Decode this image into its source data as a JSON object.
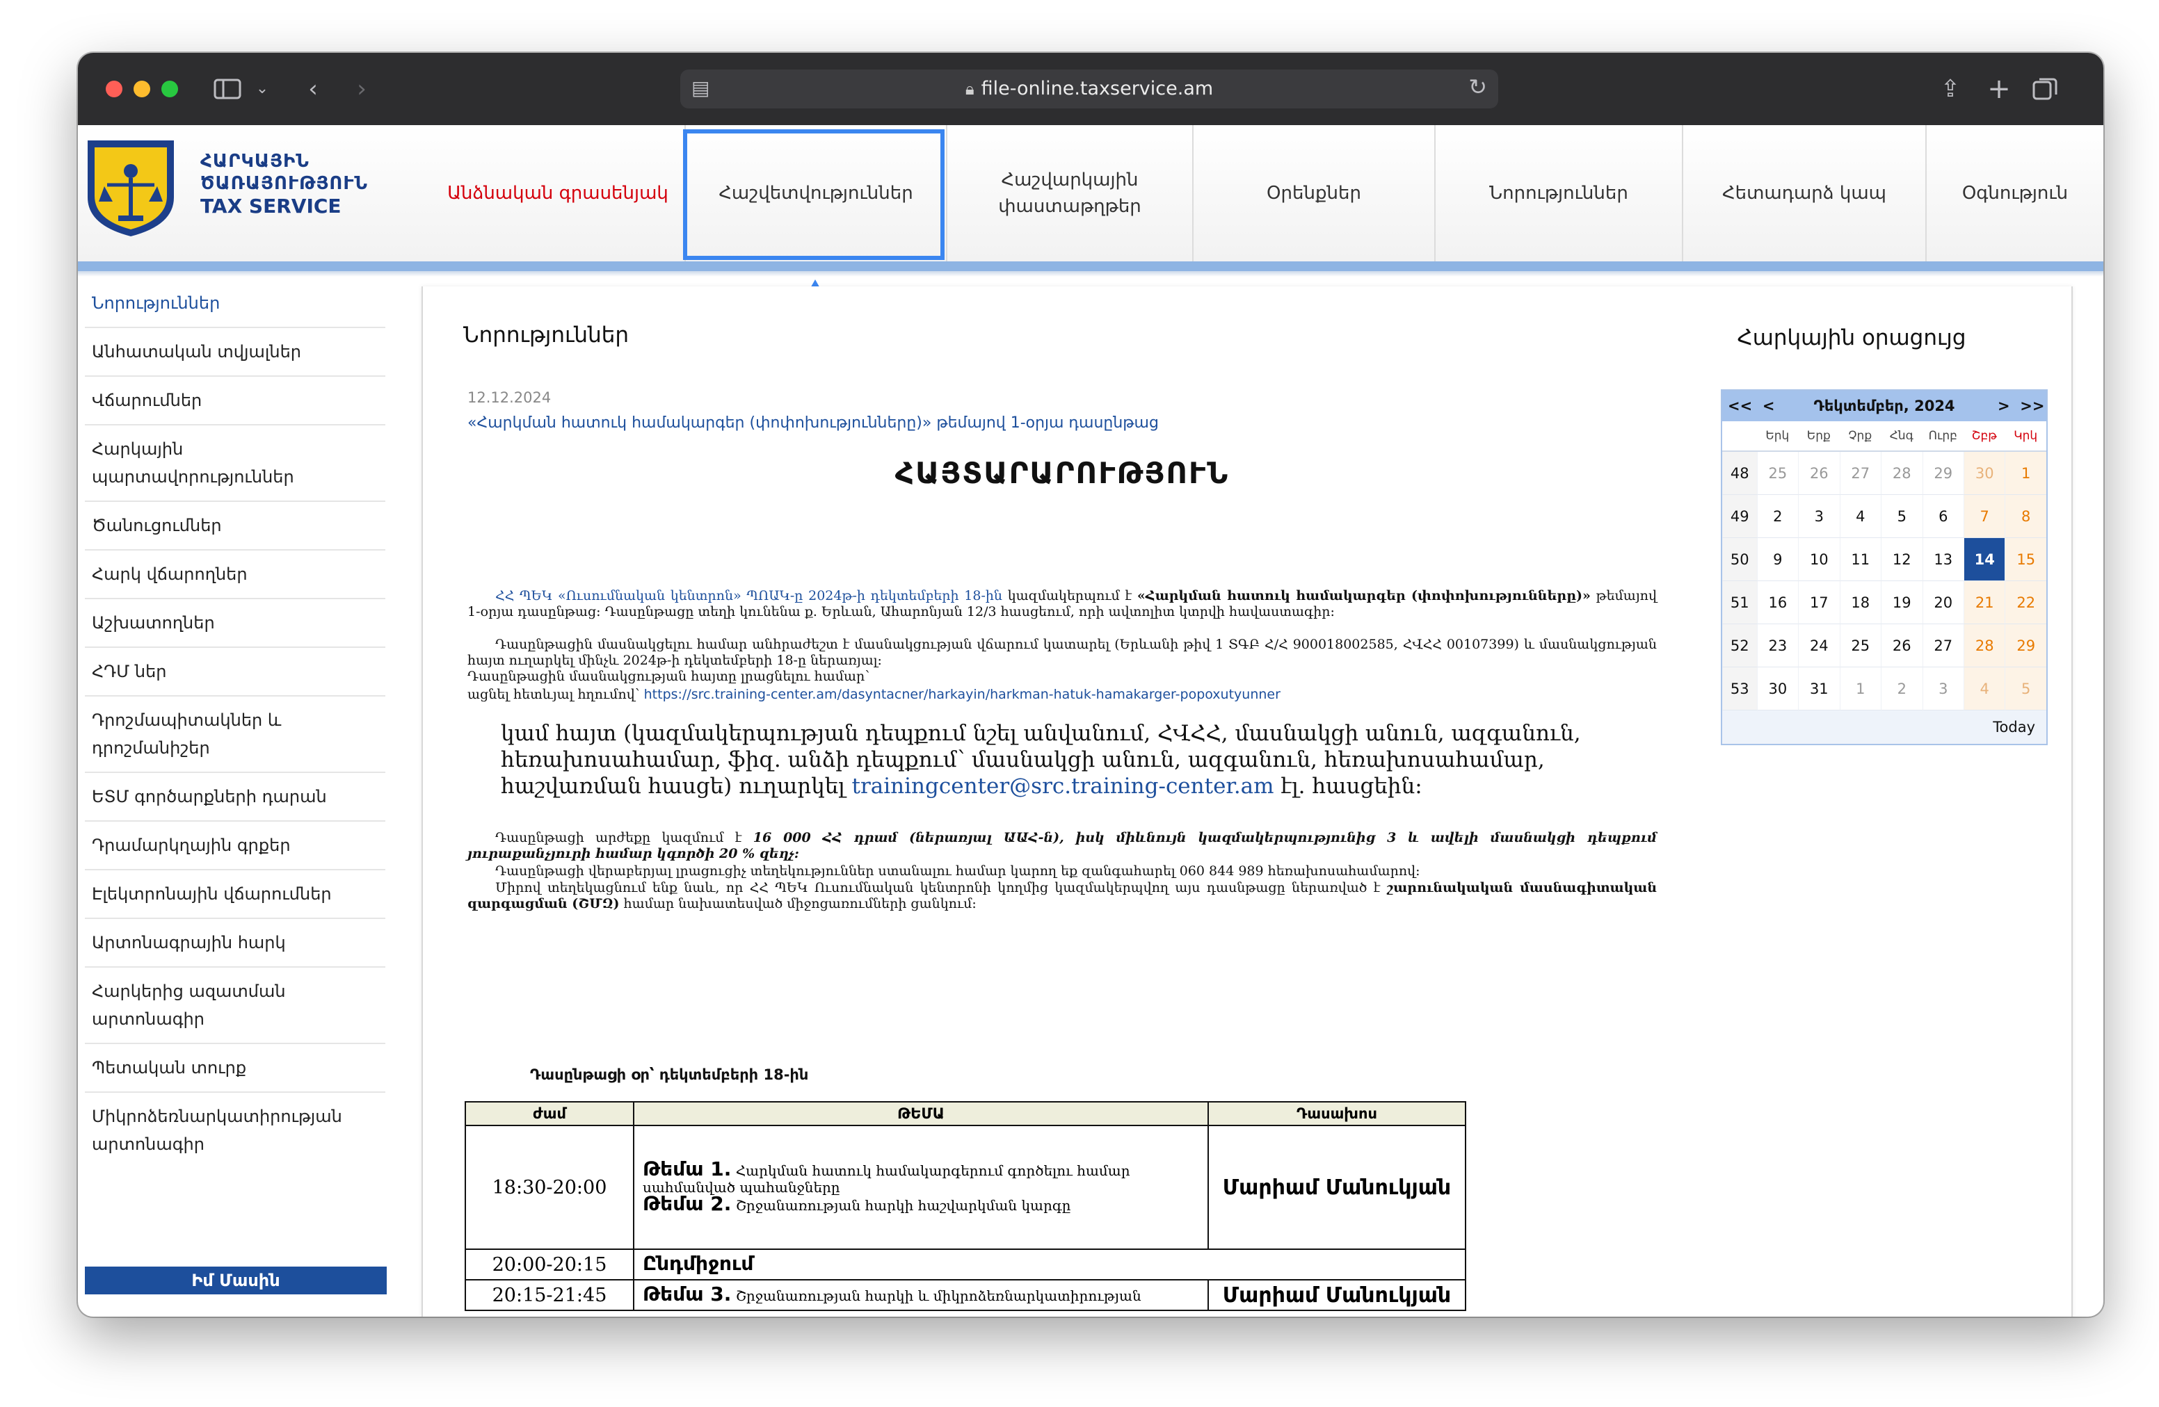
{
  "browser": {
    "url": "file-online.taxservice.am"
  },
  "site": {
    "logo_line1": "ՀԱՐԿԱՅԻՆ",
    "logo_line2": "ԾԱՌԱՅՈՒԹՅՈՒՆ",
    "logo_line3": "TAX SERVICE",
    "nav": [
      {
        "label": "Անձնական գրասենյակ"
      },
      {
        "label": "Հաշվետվություններ"
      },
      {
        "label": "Հաշվարկային փաստաթղթեր"
      },
      {
        "label": "Օրենքներ"
      },
      {
        "label": "Նորություններ"
      },
      {
        "label": "Հետադարձ կապ"
      },
      {
        "label": "Օգնություն"
      }
    ]
  },
  "sidebar": {
    "items": [
      {
        "label": "Նորություններ"
      },
      {
        "label": "Անհատական տվյալներ"
      },
      {
        "label": "Վճարումներ"
      },
      {
        "label": "Հարկային պարտավորություններ"
      },
      {
        "label": "Ծանուցումներ"
      },
      {
        "label": "Հարկ վճարողներ"
      },
      {
        "label": "Աշխատողներ"
      },
      {
        "label": "ՀԴՄ ներ"
      },
      {
        "label": "Դրոշմապիտակներ և դրոշմանիշեր"
      },
      {
        "label": "ԵՏՄ գործարքների դարան"
      },
      {
        "label": "Դրամարկղային գրքեր"
      },
      {
        "label": "Էլեկտրոնային վճարումներ"
      },
      {
        "label": "Արտոնագրային հարկ"
      },
      {
        "label": "Հարկերից ազատման արտոնագիր"
      },
      {
        "label": "Պետական տուրք"
      },
      {
        "label": "Միկրոձեռնարկատիրության արտոնագիր"
      }
    ],
    "bottom_button": "Իմ Մասին"
  },
  "news": {
    "section_title": "Նորություններ",
    "date": "12.12.2024",
    "headline": "«Հարկման հատուկ համակարգեր (փոփոխությունները)» թեմայով 1-օրյա դասընթաց",
    "announcement": "ՀԱՅՏԱՐԱՐՈՒԹՅՈՒՆ",
    "p1_blue": "ՀՀ ՊԵԿ «Ուսումնական կենտրոն» ՊՈԱԿ-ը 2024թ-ի դեկտեմբերի 18-ին",
    "p1_rest_a": " կազմակերպում է ",
    "p1_bold": "«Հարկման հատուկ համակարգեր (փոփոխությունները)»",
    "p1_rest_b": " թեմայով 1-օրյա դասընթաց: Դասընթացը տեղի կունենա ք. Երևան, Ահարոնյան 12/3 հասցեում, որի ավտոլիտ կտրվի հավաստագիր:",
    "p2": "Դասընթացին մասնակցելու համար անհրաժեշտ է մասնակցության վճարում կատարել (Երևանի թիվ 1 ՏԳԲ Հ/Հ 900018002585, ՀՎՀՀ 00107399) և մասնակցության հայտ ուղարկել մինչև 2024թ-ի դեկտեմբերի 18-ը ներառյալ:",
    "p3": "Դասընթացին մասնակցության հայտը լրացնելու համար՝",
    "p4_prefix": "ացնել հետևյալ հղումով՝ ",
    "p4_link": "https://src.training-center.am/dasyntacner/harkayin/harkman-hatuk-hamakarger-popoxutyunner",
    "big_text": "կամ հայտ (կազմակերպության դեպքում նշել անվանում, ՀՎՀՀ, մասնակցի անուն, ազգանուն, հեռախոսահամար, ֆիզ. անձի դեպքում՝ մասնակցի անուն, ազգանուն, հեռախոսահամար, հաշվառման հասցե) ուղարկել ",
    "big_email": "trainingcenter@src.training-center.am",
    "big_tail": " էլ. հասցեին:",
    "p5_a": "Դասընթացի արժեքը կազմում է ",
    "p5_bold": "16 000 ՀՀ դրամ (ներառյալ ԱԱՀ-ն), իսկ միևնույն կազմակերպությունից 3 և ավելի մասնակցի դեպքում յուրաքանչյուրի համար կգործի 20 % զեղչ:",
    "p6": "Դասընթացի վերաբերյալ լրացուցիչ տեղեկություններ ստանալու համար կարող եք զանգահարել 060 844 989 հեռախոսահամարով:",
    "p7_a": "Միրով տեղեկացնում ենք նաև, որ ՀՀ ՊԵԿ Ուսումնական կենտրոնի կողմից կազմակերպվող այս դասնթացը ներառված է ",
    "p7_bold1": "շարունակական մասնագիտական զարգացման (ՇՄԶ)",
    "p7_b": " համար նախատեսված միջոցառումների ցանկում:",
    "lesson_day": "Դասընթացի օր՝ դեկտեմբերի 18-ին",
    "schedule": {
      "headers": [
        "ժամ",
        "ԹԵՄԱ",
        "Դասախոս"
      ],
      "rows": [
        {
          "time": "18:30-20:00",
          "topic1_title": "Թեմա 1.",
          "topic1_text": "Հարկման հատուկ համակարգերում գործելու համար սահմանված պահանջները",
          "topic2_title": "Թեմա 2.",
          "topic2_text": "Շրջանառության հարկի հաշվարկման կարգը",
          "teacher": "Մարիամ Մանուկյան"
        },
        {
          "time": "20:00-20:15",
          "topic1_title": "Ընդմիջում"
        },
        {
          "time": "20:15-21:45",
          "topic1_title": "Թեմա 3.",
          "topic1_text": "Շրջանառության հարկի և միկրոձեռնարկատիրության",
          "teacher": "Մարիամ Մանուկյան"
        }
      ]
    }
  },
  "calendar": {
    "title": "Հարկային օրացույց",
    "prev_year": "<<",
    "prev_month": "<",
    "month_label": "Դեկտեմբեր, 2024",
    "next_month": ">",
    "next_year": ">>",
    "weekdays": [
      "Երկ",
      "Երք",
      "Չրք",
      "Հնգ",
      "Ուրբ",
      "Շբթ",
      "Կրկ"
    ],
    "weeks": [
      {
        "wk": "48",
        "days": [
          "25",
          "26",
          "27",
          "28",
          "29",
          "30",
          "1"
        ]
      },
      {
        "wk": "49",
        "days": [
          "2",
          "3",
          "4",
          "5",
          "6",
          "7",
          "8"
        ]
      },
      {
        "wk": "50",
        "days": [
          "9",
          "10",
          "11",
          "12",
          "13",
          "14",
          "15"
        ]
      },
      {
        "wk": "51",
        "days": [
          "16",
          "17",
          "18",
          "19",
          "20",
          "21",
          "22"
        ]
      },
      {
        "wk": "52",
        "days": [
          "23",
          "24",
          "25",
          "26",
          "27",
          "28",
          "29"
        ]
      },
      {
        "wk": "53",
        "days": [
          "30",
          "31",
          "1",
          "2",
          "3",
          "4",
          "5"
        ]
      }
    ],
    "today": "14",
    "today_label": "Today",
    "colors": {
      "header": "#a4c2ec",
      "today": "#1d4f9c",
      "weekend": "#e87a00"
    }
  },
  "colors": {
    "brand_blue": "#1d4f9c",
    "active_red": "#d4000c",
    "highlight": "#3b86f0"
  }
}
